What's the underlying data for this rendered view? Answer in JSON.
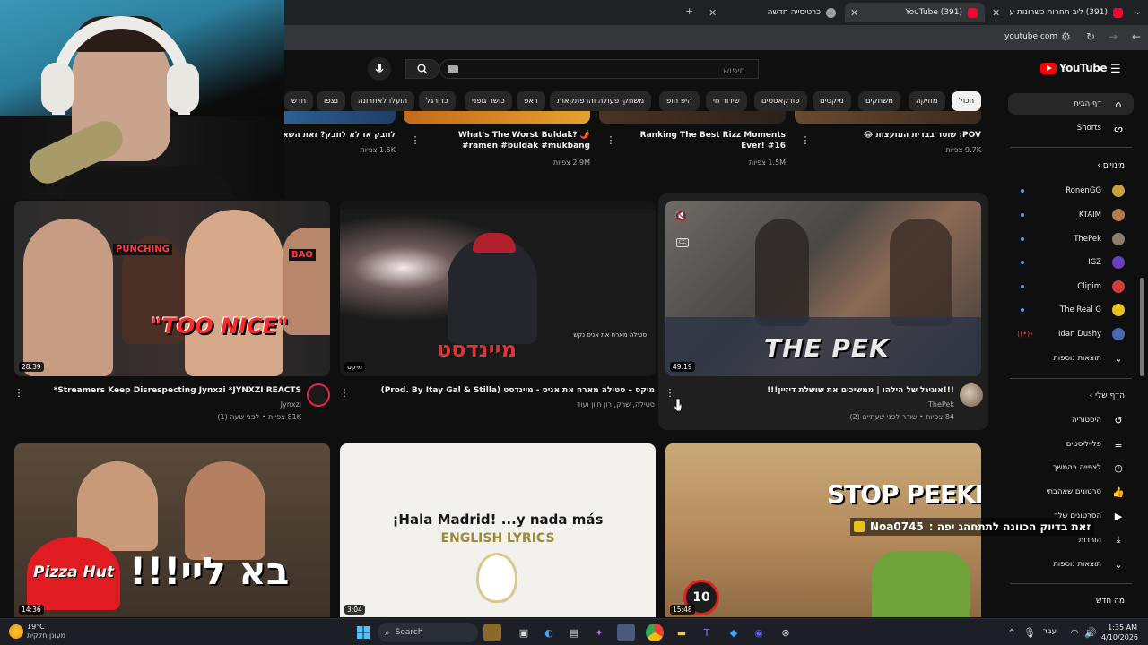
{
  "browser": {
    "tabs": [
      {
        "title": "(391) ליב תחרות כשרונות ע",
        "active": false
      },
      {
        "title": "(391) YouTube",
        "active": true
      },
      {
        "title": "כרטיסייה חדשה",
        "active": false
      }
    ],
    "url": "youtube.com"
  },
  "header": {
    "logo": "YouTube",
    "search_placeholder": "חיפוש"
  },
  "chips": [
    "הכול",
    "מוזיקה",
    "משחקים",
    "מיקסים",
    "פודקאסטים",
    "שידור חי",
    "היפ הופ",
    "משחקי פעולה והרפתקאות",
    "ראפ",
    "כושר גופני",
    "כדורגל",
    "הועלו לאחרונה",
    "נצפו",
    "חדש"
  ],
  "sidebar": {
    "home": "דף הבית",
    "shorts": "Shorts",
    "subscriptions_title": "מינויים",
    "subscriptions": [
      {
        "name": "RonenGG",
        "live": false,
        "color": "#c9a13a"
      },
      {
        "name": "KTAIM",
        "live": false,
        "color": "#b07a52"
      },
      {
        "name": "ThePek",
        "live": false,
        "color": "#8a7d6b"
      },
      {
        "name": "IGZ",
        "live": false,
        "color": "#6a3fbf"
      },
      {
        "name": "Clipim",
        "live": false,
        "color": "#d33b3b"
      },
      {
        "name": "The Real G",
        "live": false,
        "color": "#e8c21a"
      },
      {
        "name": "Idan Dushy",
        "live": true,
        "color": "#4a66b5"
      }
    ],
    "show_more": "תוצאות נוספות",
    "you_title": "הדף שלי",
    "you_items": [
      "היסטוריה",
      "פלייליסטים",
      "לצפייה בהמשך",
      "סרטונים שאהבתי",
      "הסרטונים שלך",
      "הורדות"
    ],
    "show_more_2": "תוצאות נוספות",
    "whats_new": "מה חדש"
  },
  "top_row": [
    {
      "title": "POV: שוטר בברית המועצות 😂",
      "meta": "9.7K צפיות"
    },
    {
      "title": "Ranking The Best Rizz Moments Ever! #16",
      "meta": "1.5M צפיות"
    },
    {
      "title": "What's The Worst Buldak? 🌶️ #ramen #buldak #mukbang",
      "meta": "2.9M צפיות"
    },
    {
      "title": "לחבק או לא לחבק? זאת השאלה",
      "meta": "1.5K צפיות"
    }
  ],
  "videos": [
    {
      "title": "!!!אוגיגל של הילהו | ממשיכים את שושלת דיזיין!!!",
      "channel": "ThePek",
      "meta": "84 צפיות • שודר לפני שעתיים (2)",
      "duration": "49:19"
    },
    {
      "title": "מיקס – סטילה מארח את אניס - מיינדסט (Prod. By Itay Gal & Stilla)",
      "channel": "סטילה, שרק, רון חיון ועוד",
      "meta": "",
      "duration": "מיקס"
    },
    {
      "title": "Streamers Keep Disrespecting Jynxzi *JYNXZI REACTS*",
      "channel": "Jynxzi",
      "meta": "81K צפיות • לפני שעה (1)",
      "duration": "28:39"
    },
    {
      "title": "",
      "channel": "",
      "meta": "",
      "duration": "15:48"
    },
    {
      "title": "",
      "channel": "",
      "meta": "",
      "duration": "3:04"
    },
    {
      "title": "",
      "channel": "",
      "meta": "",
      "duration": "14:36"
    }
  ],
  "thumb_texts": {
    "stop_peeking": "STOP PEEKING",
    "hala_madrid": "¡Hala Madrid! ...y nada más",
    "english_lyrics": "ENGLISH LYRICS",
    "too_nice": "\"TOO NICE\"",
    "punching": "PUNCHING",
    "bao": "BAO",
    "pizza_hut": "Pizza Hut",
    "ba_li": "בא ליי!!!",
    "mindset": "מיינדסט",
    "stila": "סטילה מארח את אניס נקש",
    "thepek_logo": "THE PEK",
    "timer": "10"
  },
  "overlay_message": {
    "user": "Noa0745",
    "text": "זאת בדיוק הכוונה לתתחהג יפה :"
  },
  "taskbar": {
    "weather_temp": "19°C",
    "weather_desc": "מעונן חלקית",
    "search": "Search",
    "lang": "עבר",
    "time": "1:35 AM",
    "date": "4/10/2026"
  }
}
